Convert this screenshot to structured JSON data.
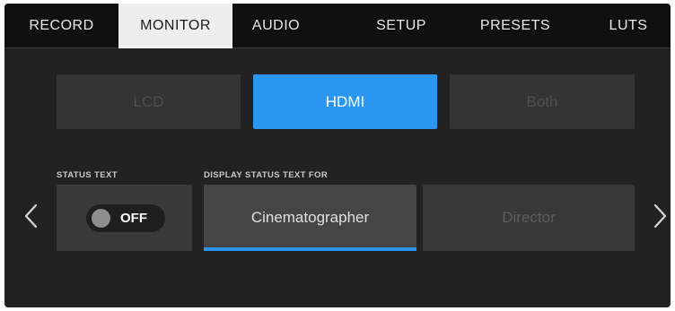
{
  "tabs": [
    {
      "label": "RECORD",
      "active": false
    },
    {
      "label": "MONITOR",
      "active": true
    },
    {
      "label": "AUDIO",
      "active": false
    },
    {
      "label": "SETUP",
      "active": false
    },
    {
      "label": "PRESETS",
      "active": false
    },
    {
      "label": "LUTS",
      "active": false
    }
  ],
  "monitor_output": {
    "options": [
      "LCD",
      "HDMI",
      "Both"
    ],
    "selected": "HDMI"
  },
  "status_text": {
    "label": "STATUS TEXT",
    "toggle_value": "OFF"
  },
  "display_status_text_for": {
    "label": "DISPLAY STATUS TEXT FOR",
    "options": [
      "Cinematographer",
      "Director"
    ],
    "selected": "Cinematographer"
  },
  "navigation": {
    "prev_icon": "chevron-left-icon",
    "next_icon": "chevron-right-icon"
  },
  "colors": {
    "accent": "#2b95f2",
    "tab_active_bg": "#eeeeee",
    "background": "#222222"
  }
}
